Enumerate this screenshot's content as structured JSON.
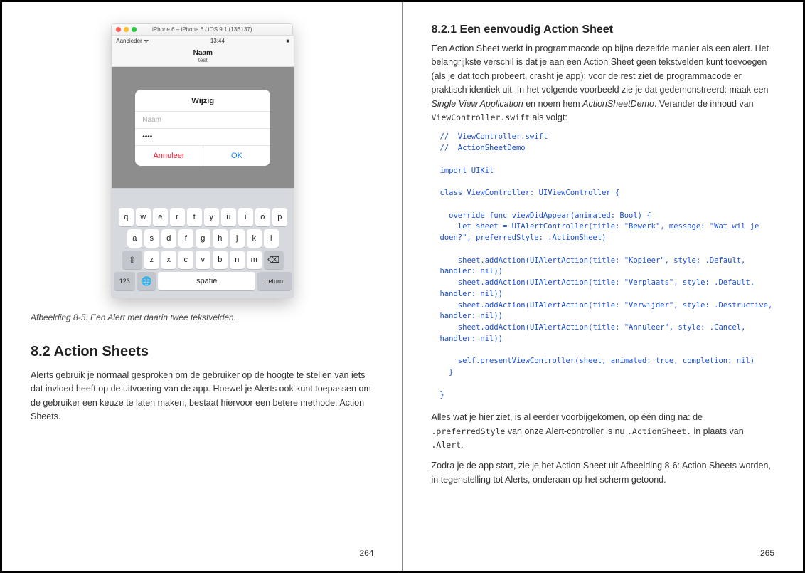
{
  "left": {
    "simulator": {
      "window_title": "iPhone 6 – iPhone 6 / iOS 9.1 (13B137)",
      "status_carrier": "Aanbieder ᯤ",
      "status_time": "13:44",
      "status_batt": "■",
      "nav_title": "Naam",
      "nav_sub": "test",
      "alert_title": "Wijzig",
      "field_placeholder": "Naam",
      "field_value": "••••",
      "btn_cancel": "Annuleer",
      "btn_ok": "OK",
      "keys_row1": [
        "q",
        "w",
        "e",
        "r",
        "t",
        "y",
        "u",
        "i",
        "o",
        "p"
      ],
      "keys_row2": [
        "a",
        "s",
        "d",
        "f",
        "g",
        "h",
        "j",
        "k",
        "l"
      ],
      "keys_row3": [
        "z",
        "x",
        "c",
        "v",
        "b",
        "n",
        "m"
      ],
      "key_shift": "⇧",
      "key_del": "⌫",
      "key_123": "123",
      "key_globe": "🌐",
      "key_space": "spatie",
      "key_return": "return"
    },
    "caption": "Afbeelding 8-5: Een Alert met daarin twee tekstvelden.",
    "section_num": "8.2 Action Sheets",
    "body1": "Alerts gebruik je normaal gesproken om de gebruiker op de hoogte te stellen van iets dat invloed heeft op de uitvoering van de app. Hoewel je Alerts ook kunt toepassen om de gebruiker een keuze te laten maken, bestaat hiervoor een betere methode: Action Sheets.",
    "pagenum": "264"
  },
  "right": {
    "subsection": "8.2.1 Een eenvoudig Action Sheet",
    "p1a": "Een Action Sheet werkt in programmacode op bijna dezelfde manier als een alert. Het belangrijkste verschil is dat je aan een Action Sheet geen tekstvelden kunt toevoegen (als je dat toch probeert, crasht je app); voor de rest ziet de programmacode er praktisch identiek uit. In het volgende voorbeeld zie je dat gedemonstreerd: maak een ",
    "p1_em1": "Single View Application",
    "p1b": " en noem hem ",
    "p1_em2": "ActionSheetDemo",
    "p1c": ". Verander de inhoud van ",
    "p1_code": "ViewController.swift",
    "p1d": " als volgt:",
    "code": "//  ViewController.swift\n//  ActionSheetDemo\n\nimport UIKit\n\nclass ViewController: UIViewController {\n\n  override func viewDidAppear(animated: Bool) {\n    let sheet = UIAlertController(title: \"Bewerk\", message: \"Wat wil je doen?\", preferredStyle: .ActionSheet)\n\n    sheet.addAction(UIAlertAction(title: \"Kopieer\", style: .Default, handler: nil))\n    sheet.addAction(UIAlertAction(title: \"Verplaats\", style: .Default, handler: nil))\n    sheet.addAction(UIAlertAction(title: \"Verwijder\", style: .Destructive, handler: nil))\n    sheet.addAction(UIAlertAction(title: \"Annuleer\", style: .Cancel, handler: nil))\n\n    self.presentViewController(sheet, animated: true, completion: nil)\n  }\n\n}",
    "p2a": "Alles wat je hier ziet, is al eerder voorbijgekomen, op één ding na: de ",
    "p2_c1": ".preferredStyle",
    "p2b": " van onze Alert-controller is nu ",
    "p2_c2": ".ActionSheet.",
    "p2c": " in plaats van ",
    "p2_c3": ".Alert",
    "p2d": ".",
    "p3": "Zodra je de app start, zie je het Action Sheet uit Afbeelding 8-6: Action Sheets worden, in tegenstelling tot Alerts, onderaan op het scherm getoond.",
    "pagenum": "265"
  }
}
